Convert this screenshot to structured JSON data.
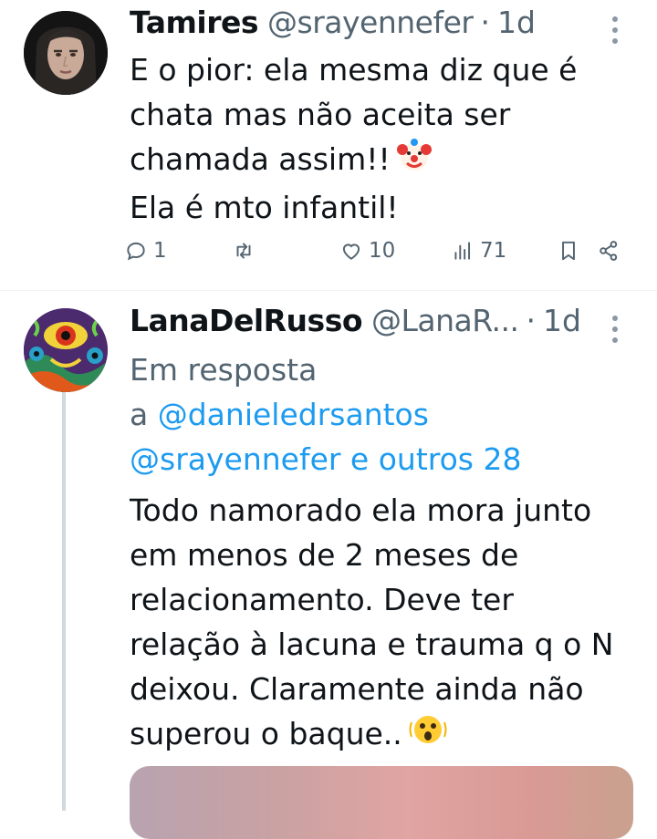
{
  "tweets": [
    {
      "name": "Tamires",
      "handle": "@srayennefer",
      "dot": "·",
      "time": "1d",
      "avatar_icon": "woman-portrait-avatar",
      "body_lines": [
        "E o pior: ela mesma diz que é",
        "chata mas não aceita ser",
        "chamada assim!!",
        "Ela é mto infantil!"
      ],
      "body_emoji": "clown-face-emoji",
      "actions": {
        "reply_count": "1",
        "retweet_count": "",
        "like_count": "10",
        "view_count": "71"
      }
    },
    {
      "name": "LanaDelRusso",
      "handle": "@LanaR...",
      "dot": "·",
      "time": "1d",
      "avatar_icon": "psychedelic-art-avatar",
      "reply_prefix": "Em resposta",
      "reply_a": "a",
      "reply_mention1": "@danieledrsantos",
      "reply_mention2": "@srayennefer e outros 28",
      "body_lines": [
        "Todo namorado ela mora junto",
        "em menos de 2 meses de",
        "relacionamento. Deve ter",
        "relação à lacuna e trauma q o N",
        "deixou. Claramente ainda não",
        "superou o baque.."
      ],
      "body_emoji": "surprised-face-emoji"
    }
  ],
  "colors": {
    "text": "#0f1419",
    "secondary": "#536471",
    "link": "#1d9bf0",
    "divider": "#eff3f4",
    "thread_line": "#cfd9de"
  }
}
